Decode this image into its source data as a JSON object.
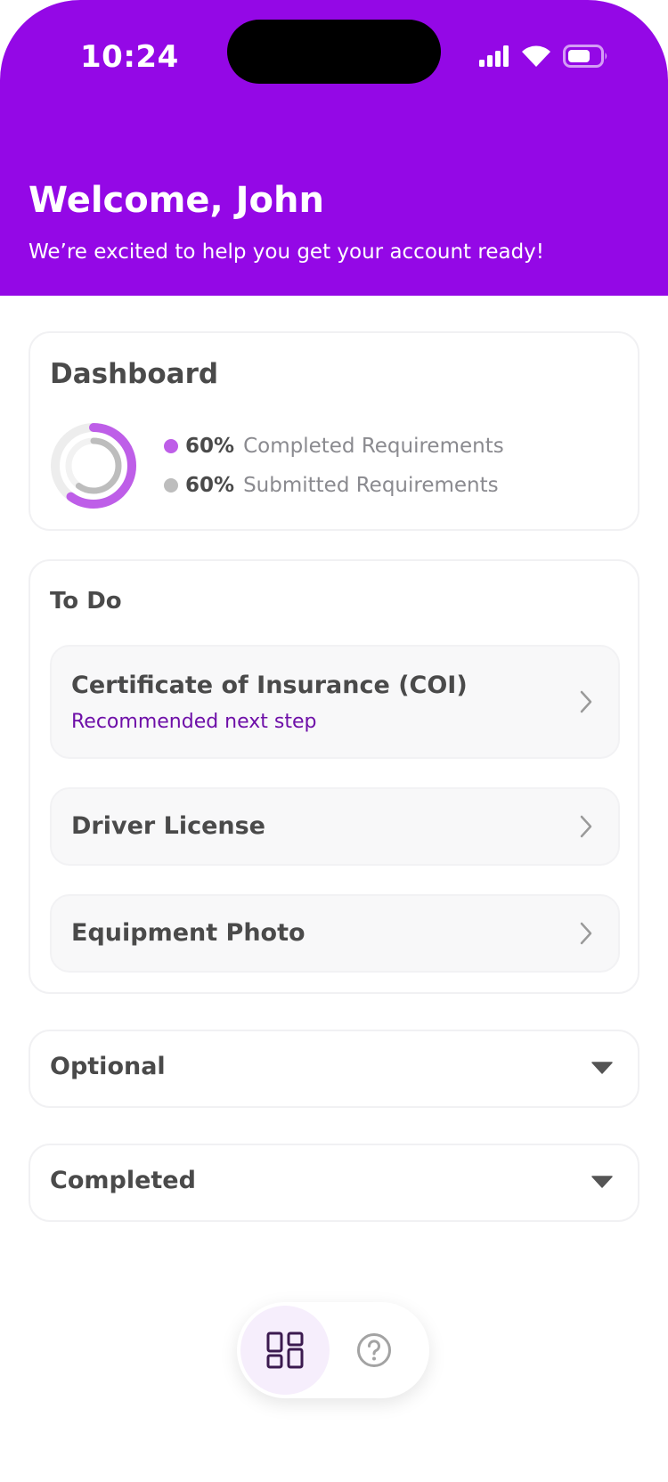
{
  "status_bar": {
    "time": "10:24",
    "icons": [
      "cellular-signal-icon",
      "wifi-icon",
      "battery-icon"
    ]
  },
  "header": {
    "title": "Welcome, John",
    "subtitle": "We’re excited to help you get your account ready!",
    "background_color": "#9408E6"
  },
  "dashboard": {
    "title": "Dashboard",
    "progress_completed": 0.6,
    "progress_submitted": 0.6,
    "legend": [
      {
        "percent": "60%",
        "label": "Completed Requirements",
        "color": "#BE5EE8"
      },
      {
        "percent": "60%",
        "label": "Submitted Requirements",
        "color": "#BDBDBD"
      }
    ]
  },
  "todo": {
    "title": "To Do",
    "items": [
      {
        "label": "Certificate of Insurance (COI)",
        "hint": "Recommended next step",
        "icon": "chevron-right-icon"
      },
      {
        "label": "Driver License",
        "icon": "chevron-right-icon"
      },
      {
        "label": "Equipment Photo",
        "icon": "chevron-right-icon"
      }
    ]
  },
  "sections": {
    "optional": {
      "label": "Optional",
      "icon": "caret-down-icon"
    },
    "completed": {
      "label": "Completed",
      "icon": "caret-down-icon"
    }
  },
  "bottom_nav": {
    "items": [
      {
        "name": "dashboard",
        "icon": "dashboard-grid-icon",
        "active": true
      },
      {
        "name": "help",
        "icon": "help-circle-icon",
        "active": false
      }
    ]
  },
  "colors": {
    "accent": "#9408E6",
    "hint_text": "#6E0FA8",
    "ring_completed": "#BE5EE8",
    "ring_submitted": "#BDBDBD"
  }
}
